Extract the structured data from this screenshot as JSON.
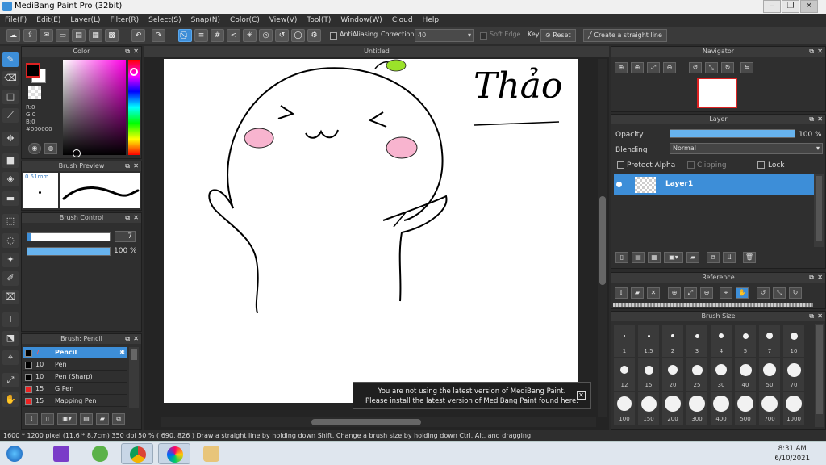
{
  "window": {
    "title": "MediBang Paint Pro (32bit)"
  },
  "menu": [
    "File(F)",
    "Edit(E)",
    "Layer(L)",
    "Filter(R)",
    "Select(S)",
    "Snap(N)",
    "Color(C)",
    "View(V)",
    "Tool(T)",
    "Window(W)",
    "Cloud",
    "Help"
  ],
  "toolbar": {
    "antialiasing_label": "AntiAliasing",
    "correction_label": "Correction",
    "correction_value": "40",
    "soft_edge_label": "Soft Edge",
    "key_label": "Key",
    "reset_label": "Reset",
    "straight_line_label": "Create a straight line"
  },
  "color_panel": {
    "title": "Color",
    "r": "R:0",
    "g": "G:0",
    "b": "B:0",
    "hex": "#000000",
    "primary": "#000000",
    "secondary": "#ffffff"
  },
  "brush_preview": {
    "title": "Brush Preview",
    "size": "0.51mm"
  },
  "brush_control": {
    "title": "Brush Control",
    "size_value": "7",
    "opacity_value": "100 %",
    "size_fill": 0.05,
    "opacity_fill": 1.0
  },
  "brush_list": {
    "title": "Brush: Pencil",
    "items": [
      {
        "size": "7",
        "name": "Pencil",
        "color": "#000000"
      },
      {
        "size": "10",
        "name": "Pen",
        "color": "#000000"
      },
      {
        "size": "10",
        "name": "Pen (Sharp)",
        "color": "#000000"
      },
      {
        "size": "15",
        "name": "G Pen",
        "color": "#ee2222"
      },
      {
        "size": "15",
        "name": "Mapping Pen",
        "color": "#ee2222"
      }
    ]
  },
  "canvas": {
    "tab_title": "Untitled",
    "signature_text": "Thảo"
  },
  "notice": {
    "line1": "You are not using the latest version of MediBang Paint.",
    "line2": "Please install the latest version of MediBang Paint found here."
  },
  "navigator": {
    "title": "Navigator"
  },
  "layer_panel": {
    "title": "Layer",
    "opacity_label": "Opacity",
    "opacity_value": "100 %",
    "opacity_fill": 1.0,
    "blending_label": "Blending",
    "blending_value": "Normal",
    "protect_alpha_label": "Protect Alpha",
    "clipping_label": "Clipping",
    "lock_label": "Lock",
    "layer_name": "Layer1"
  },
  "reference_panel": {
    "title": "Reference"
  },
  "brush_size_panel": {
    "title": "Brush Size",
    "sizes": [
      "1",
      "1.5",
      "2",
      "3",
      "4",
      "5",
      "7",
      "10",
      "12",
      "15",
      "20",
      "25",
      "30",
      "40",
      "50",
      "70",
      "100",
      "150",
      "200",
      "300",
      "400",
      "500",
      "700",
      "1000"
    ]
  },
  "status": {
    "text": "1600 * 1200 pixel   (11.6 * 8.7cm)   350 dpi   50 %   ( 690, 826 )   Draw a straight line by holding down Shift, Change a brush size by holding down Ctrl, Alt, and dragging"
  },
  "taskbar": {
    "time": "8:31 AM",
    "date": "6/10/2021"
  }
}
